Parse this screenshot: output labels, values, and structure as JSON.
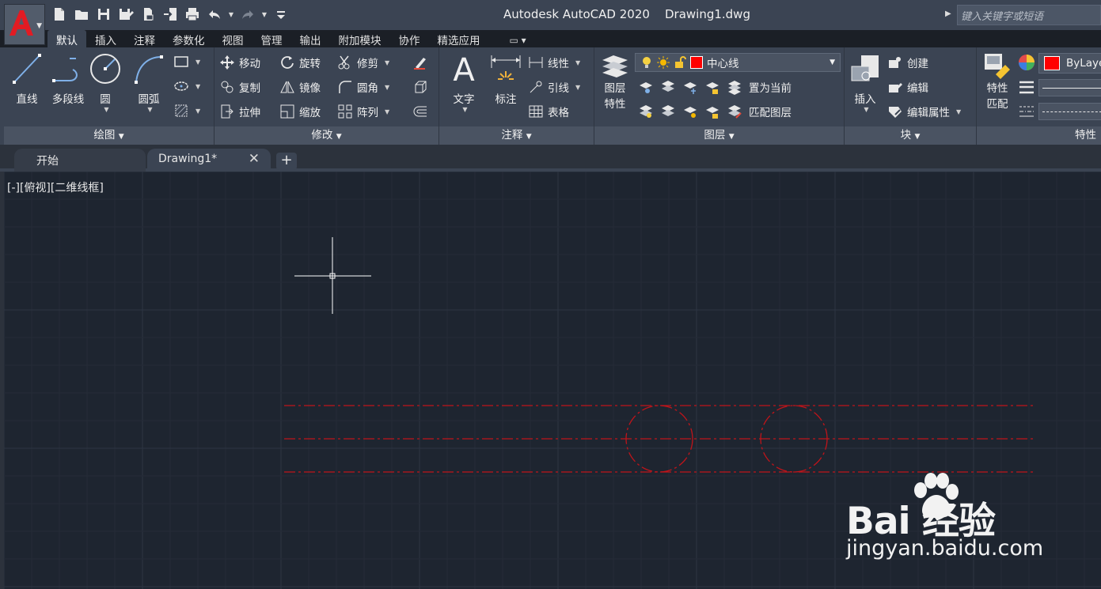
{
  "window": {
    "title": "Autodesk AutoCAD 2020    Drawing1.dwg",
    "search_placeholder": "键入关键字或短语"
  },
  "quick_access": [
    "new-file-icon",
    "open-folder-icon",
    "save-icon",
    "save-as-icon",
    "cloud-open-icon",
    "share-icon",
    "plot-icon",
    "undo-icon",
    "redo-icon",
    "customize-icon"
  ],
  "ribbon_tabs": [
    "默认",
    "插入",
    "注释",
    "参数化",
    "视图",
    "管理",
    "输出",
    "附加模块",
    "协作",
    "精选应用"
  ],
  "ribbon": {
    "draw": {
      "title": "绘图",
      "line": "直线",
      "polyline": "多段线",
      "circle": "圆",
      "arc": "圆弧"
    },
    "modify": {
      "title": "修改",
      "move": "移动",
      "rotate": "旋转",
      "trim": "修剪",
      "copy": "复制",
      "mirror": "镜像",
      "fillet": "圆角",
      "stretch": "拉伸",
      "scale": "缩放",
      "array": "阵列"
    },
    "annotation": {
      "title": "注释",
      "text": "文字",
      "dimension": "标注",
      "linear": "线性",
      "leader": "引线",
      "table": "表格"
    },
    "layers": {
      "title": "图层",
      "properties_line1": "图层",
      "properties_line2": "特性",
      "current_layer": "中心线",
      "current_layer_color": "#ff0000",
      "set_current": "置为当前",
      "match_layer": "匹配图层"
    },
    "block": {
      "title": "块",
      "insert": "插入",
      "create": "创建",
      "edit": "编辑",
      "edit_attributes": "编辑属性"
    },
    "properties": {
      "title": "特性",
      "match_line1": "特性",
      "match_line2": "匹配",
      "color_value": "ByLayer",
      "color_swatch": "#ff0000"
    }
  },
  "doc_tabs": {
    "start": "开始",
    "drawing": "Drawing1*"
  },
  "viewport": {
    "label": "[-][俯视][二维线框]"
  },
  "drawing": {
    "line_color": "#c0141a",
    "linetype": "center"
  },
  "watermark": {
    "brand": "Bai 经验",
    "url": "jingyan.baidu.com"
  }
}
